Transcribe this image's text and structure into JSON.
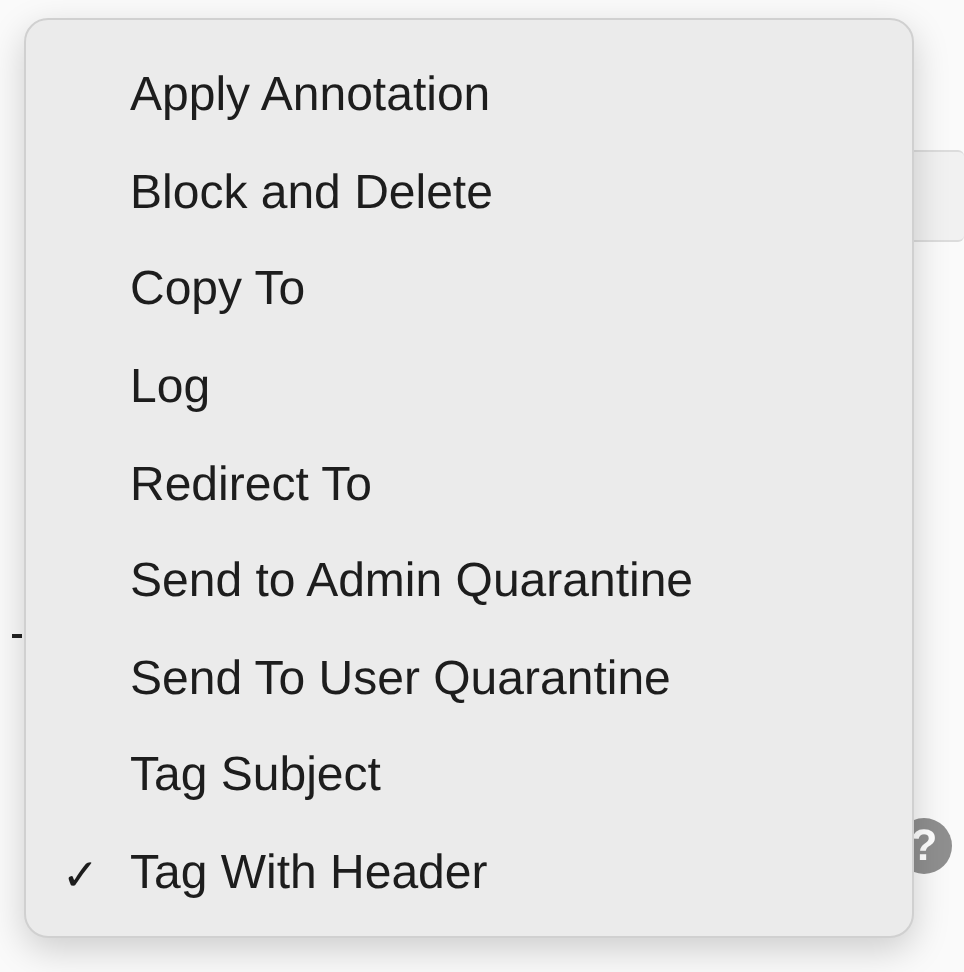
{
  "menu": {
    "check_mark": "✓",
    "items": [
      {
        "label": "Apply Annotation",
        "checked": false
      },
      {
        "label": "Block and Delete",
        "checked": false
      },
      {
        "label": "Copy To",
        "checked": false
      },
      {
        "label": "Log",
        "checked": false
      },
      {
        "label": "Redirect To",
        "checked": false
      },
      {
        "label": "Send to Admin Quarantine",
        "checked": false
      },
      {
        "label": "Send To User Quarantine",
        "checked": false
      },
      {
        "label": "Tag Subject",
        "checked": false
      },
      {
        "label": "Tag With Header",
        "checked": true
      }
    ]
  },
  "help_button": {
    "label": "?"
  }
}
